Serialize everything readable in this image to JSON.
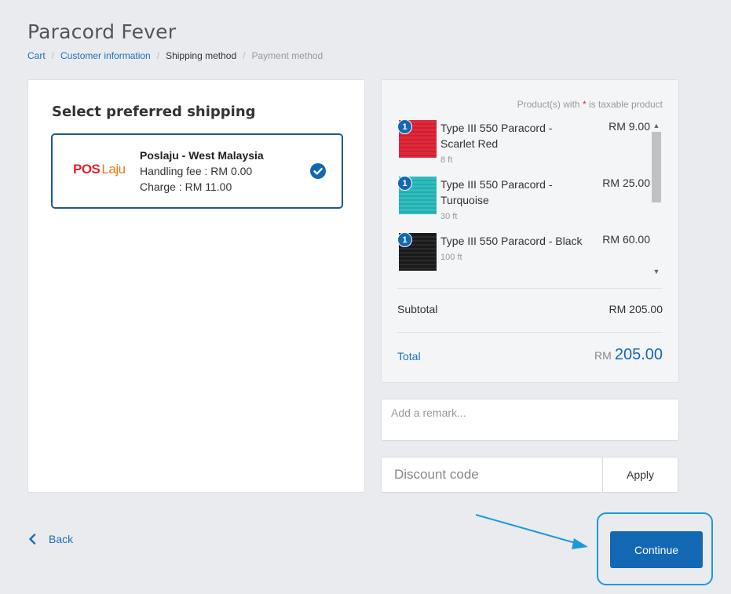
{
  "store": {
    "title": "Paracord Fever"
  },
  "breadcrumb": {
    "cart": "Cart",
    "customer_information": "Customer information",
    "shipping_method": "Shipping method",
    "payment_method": "Payment method",
    "separator": "/"
  },
  "shipping": {
    "heading": "Select preferred shipping",
    "option": {
      "logo_pos": "POS",
      "logo_laju": "Laju",
      "name": "Poslaju - West Malaysia",
      "handling_fee": "Handling fee : RM 0.00",
      "charge": "Charge : RM 11.00",
      "selected": true,
      "icon": "check-circle-icon"
    }
  },
  "summary": {
    "tax_note_prefix": "Product(s) with ",
    "tax_note_star": "*",
    "tax_note_suffix": " is taxable product",
    "items": [
      {
        "qty": "1",
        "name": "Type III 550 Paracord - Scarlet Red",
        "variant": "8 ft",
        "price": "RM 9.00",
        "color": "#e0293a"
      },
      {
        "qty": "1",
        "name": "Type III 550 Paracord - Turquoise",
        "variant": "30 ft",
        "price": "RM 25.00",
        "color": "#2fbdbd"
      },
      {
        "qty": "1",
        "name": "Type III 550 Paracord - Black",
        "variant": "100 ft",
        "price": "RM 60.00",
        "color": "#1a1a1a"
      }
    ],
    "subtotal_label": "Subtotal",
    "subtotal_value": "RM 205.00",
    "total_label": "Total",
    "total_currency": "RM",
    "total_amount": "205.00"
  },
  "remark": {
    "placeholder": "Add a remark..."
  },
  "discount": {
    "placeholder": "Discount code",
    "apply_label": "Apply"
  },
  "nav": {
    "back_label": "Back",
    "continue_label": "Continue"
  },
  "colors": {
    "accent": "#1368b4",
    "link": "#1d6fb8",
    "annotation": "#1d9ad6"
  }
}
